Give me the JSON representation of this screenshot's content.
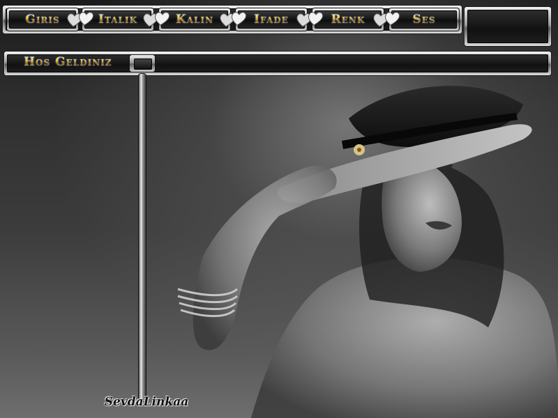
{
  "nav": {
    "items": [
      {
        "label": "Giris"
      },
      {
        "label": "Italik"
      },
      {
        "label": "Kalin"
      },
      {
        "label": "Ifade"
      },
      {
        "label": "Renk"
      },
      {
        "label": "Ses"
      }
    ],
    "divider_icon": "twin-hearts-icon"
  },
  "welcome": {
    "text": "Hos Geldiniz"
  },
  "signature": {
    "text": "SevdaLinkaa"
  },
  "colors": {
    "text_gold": "#f0c040",
    "text_glow": "#508cff",
    "chrome": "#9a9a9a",
    "panel": "#111111",
    "background": "#2a2a2a"
  }
}
